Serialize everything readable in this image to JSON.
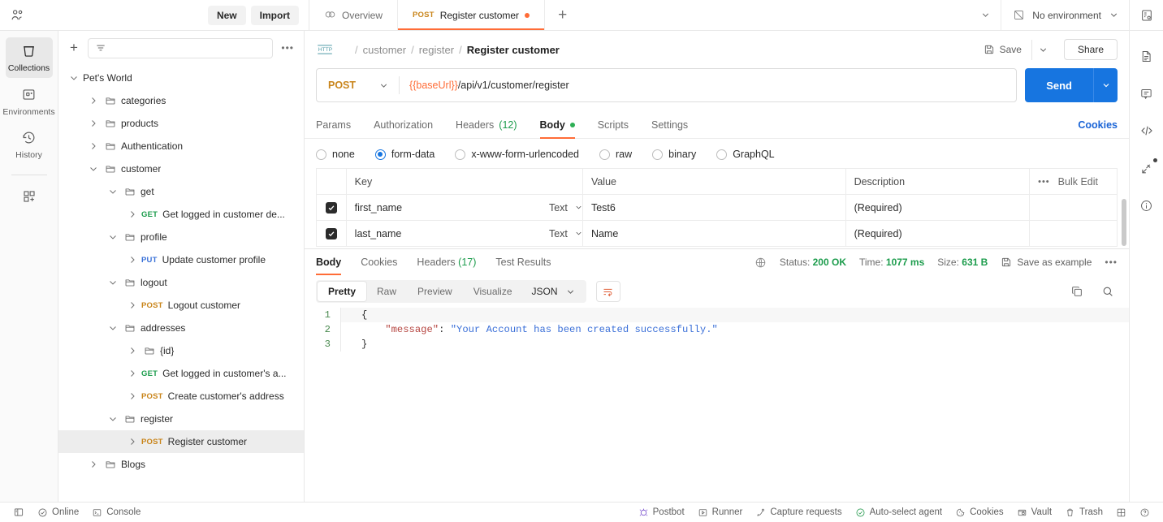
{
  "topbar": {
    "people_icon": "people-icon",
    "new_label": "New",
    "import_label": "Import",
    "tabs": [
      {
        "label": "Overview",
        "icon": "overview-icon",
        "method": "",
        "active": false,
        "unsaved": false
      },
      {
        "label": "Register customer",
        "icon": "",
        "method": "POST",
        "active": true,
        "unsaved": true
      }
    ],
    "add_tab": "+",
    "environment": "No environment"
  },
  "rail": {
    "items": [
      {
        "label": "Collections",
        "icon": "collections-icon",
        "active": true
      },
      {
        "label": "Environments",
        "icon": "environments-icon",
        "active": false
      },
      {
        "label": "History",
        "icon": "history-icon",
        "active": false
      }
    ],
    "add_item": "new-module-icon"
  },
  "sidebar": {
    "plus": "+",
    "filter_placeholder": "",
    "more": "•••",
    "tree": [
      {
        "label": "Pet's World",
        "depth": 0,
        "type": "collection",
        "caret": "down",
        "method": "",
        "selected": false
      },
      {
        "label": "categories",
        "depth": 1,
        "type": "folder",
        "caret": "right",
        "method": "",
        "selected": false
      },
      {
        "label": "products",
        "depth": 1,
        "type": "folder",
        "caret": "right",
        "method": "",
        "selected": false
      },
      {
        "label": "Authentication",
        "depth": 1,
        "type": "folder",
        "caret": "right",
        "method": "",
        "selected": false
      },
      {
        "label": "customer",
        "depth": 1,
        "type": "folder",
        "caret": "down",
        "method": "",
        "selected": false
      },
      {
        "label": "get",
        "depth": 2,
        "type": "folder",
        "caret": "down",
        "method": "",
        "selected": false
      },
      {
        "label": "Get logged in customer de...",
        "depth": 3,
        "type": "request",
        "caret": "right",
        "method": "GET",
        "selected": false
      },
      {
        "label": "profile",
        "depth": 2,
        "type": "folder",
        "caret": "down",
        "method": "",
        "selected": false
      },
      {
        "label": "Update customer profile",
        "depth": 3,
        "type": "request",
        "caret": "right",
        "method": "PUT",
        "selected": false
      },
      {
        "label": "logout",
        "depth": 2,
        "type": "folder",
        "caret": "down",
        "method": "",
        "selected": false
      },
      {
        "label": "Logout customer",
        "depth": 3,
        "type": "request",
        "caret": "right",
        "method": "POST",
        "selected": false
      },
      {
        "label": "addresses",
        "depth": 2,
        "type": "folder",
        "caret": "down",
        "method": "",
        "selected": false
      },
      {
        "label": "{id}",
        "depth": 3,
        "type": "folder",
        "caret": "right",
        "method": "",
        "selected": false
      },
      {
        "label": "Get logged in customer's a...",
        "depth": 3,
        "type": "request",
        "caret": "right",
        "method": "GET",
        "selected": false
      },
      {
        "label": "Create customer's address",
        "depth": 3,
        "type": "request",
        "caret": "right",
        "method": "POST",
        "selected": false
      },
      {
        "label": "register",
        "depth": 2,
        "type": "folder",
        "caret": "down",
        "method": "",
        "selected": false
      },
      {
        "label": "Register customer",
        "depth": 3,
        "type": "request",
        "caret": "right",
        "method": "POST",
        "selected": true
      },
      {
        "label": "Blogs",
        "depth": 1,
        "type": "folder",
        "caret": "right",
        "method": "",
        "selected": false
      }
    ]
  },
  "request": {
    "protocol_icon": "http-icon",
    "breadcrumb": [
      {
        "label": "customer",
        "current": false
      },
      {
        "label": "register",
        "current": false
      },
      {
        "label": "Register customer",
        "current": true
      }
    ],
    "save_label": "Save",
    "share_label": "Share",
    "method": "POST",
    "url_variable": "{{baseUrl}}",
    "url_path": "/api/v1/customer/register",
    "send_label": "Send",
    "tabs": [
      {
        "label": "Params",
        "count": "",
        "active": false,
        "dot": false
      },
      {
        "label": "Authorization",
        "count": "",
        "active": false,
        "dot": false
      },
      {
        "label": "Headers",
        "count": "(12)",
        "active": false,
        "dot": false
      },
      {
        "label": "Body",
        "count": "",
        "active": true,
        "dot": true
      },
      {
        "label": "Scripts",
        "count": "",
        "active": false,
        "dot": false
      },
      {
        "label": "Settings",
        "count": "",
        "active": false,
        "dot": false
      }
    ],
    "cookies_link": "Cookies",
    "body_types": [
      {
        "label": "none",
        "selected": false
      },
      {
        "label": "form-data",
        "selected": true
      },
      {
        "label": "x-www-form-urlencoded",
        "selected": false
      },
      {
        "label": "raw",
        "selected": false
      },
      {
        "label": "binary",
        "selected": false
      },
      {
        "label": "GraphQL",
        "selected": false
      }
    ],
    "table": {
      "headers": {
        "key": "Key",
        "value": "Value",
        "description": "Description",
        "bulk_edit": "Bulk Edit",
        "dots": "•••"
      },
      "rows": [
        {
          "checked": true,
          "key": "first_name",
          "type": "Text",
          "value": "Test6",
          "description": "(Required)"
        },
        {
          "checked": true,
          "key": "last_name",
          "type": "Text",
          "value": "Name",
          "description": "(Required)"
        }
      ]
    }
  },
  "response": {
    "tabs": [
      {
        "label": "Body",
        "count": "",
        "active": true
      },
      {
        "label": "Cookies",
        "count": "",
        "active": false
      },
      {
        "label": "Headers",
        "count": "(17)",
        "active": false
      },
      {
        "label": "Test Results",
        "count": "",
        "active": false
      }
    ],
    "status_label": "Status:",
    "status_value": "200 OK",
    "time_label": "Time:",
    "time_value": "1077 ms",
    "size_label": "Size:",
    "size_value": "631 B",
    "save_example": "Save as example",
    "more": "•••",
    "view_modes": [
      {
        "label": "Pretty",
        "active": true
      },
      {
        "label": "Raw",
        "active": false
      },
      {
        "label": "Preview",
        "active": false
      },
      {
        "label": "Visualize",
        "active": false
      }
    ],
    "language": "JSON",
    "code_lines": [
      {
        "no": "1",
        "segments": [
          {
            "t": "{",
            "c": "plain"
          }
        ]
      },
      {
        "no": "2",
        "segments": [
          {
            "t": "    ",
            "c": "plain"
          },
          {
            "t": "\"message\"",
            "c": "key"
          },
          {
            "t": ": ",
            "c": "plain"
          },
          {
            "t": "\"Your Account has been created successfully.\"",
            "c": "str"
          }
        ]
      },
      {
        "no": "3",
        "segments": [
          {
            "t": "}",
            "c": "plain"
          }
        ]
      }
    ]
  },
  "right_rail": {
    "items": [
      {
        "icon": "environment-quick-look-icon"
      },
      {
        "icon": "documentation-icon"
      },
      {
        "icon": "comments-icon"
      },
      {
        "icon": "code-snippet-icon"
      },
      {
        "icon": "related-requests-icon",
        "badge": true
      },
      {
        "icon": "info-icon"
      }
    ]
  },
  "statusbar": {
    "left": [
      {
        "label": "",
        "icon": "sidebar-toggle-icon"
      },
      {
        "label": "Online",
        "icon": "online-icon"
      },
      {
        "label": "Console",
        "icon": "console-icon"
      }
    ],
    "right": [
      {
        "label": "Postbot",
        "icon": "postbot-icon"
      },
      {
        "label": "Runner",
        "icon": "runner-icon"
      },
      {
        "label": "Capture requests",
        "icon": "capture-icon"
      },
      {
        "label": "Auto-select agent",
        "icon": "agent-icon"
      },
      {
        "label": "Cookies",
        "icon": "cookies-icon"
      },
      {
        "label": "Vault",
        "icon": "vault-icon"
      },
      {
        "label": "Trash",
        "icon": "trash-icon"
      },
      {
        "label": "",
        "icon": "layout-icon"
      },
      {
        "label": "",
        "icon": "help-icon"
      }
    ]
  },
  "colors": {
    "accent": "#ff6c37",
    "send": "#1775e0",
    "success": "#1c9c4c",
    "link": "#1a64d6",
    "post": "#c9851b",
    "get": "#1c9c4c",
    "put": "#3a71d8"
  }
}
